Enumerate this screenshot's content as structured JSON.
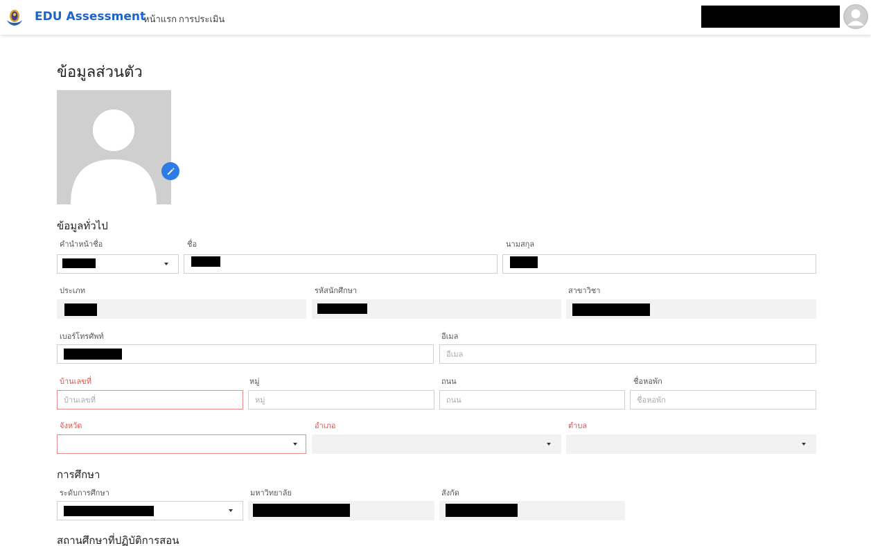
{
  "navbar": {
    "brand": "EDU Assessment",
    "links": [
      "หน้าแรก",
      "การประเมิน"
    ]
  },
  "page": {
    "title": "ข้อมูลส่วนตัว"
  },
  "sections": {
    "general": "ข้อมูลทั่วไป",
    "education": "การศึกษา",
    "practice_school": "สถานศึกษาที่ปฏิบัติการสอน"
  },
  "labels": {
    "prefix": "คำนำหน้าชื่อ",
    "first_name": "ชื่อ",
    "last_name": "นามสกุล",
    "type": "ประเภท",
    "student_id": "รหัสนักศึกษา",
    "major": "สาขาวิชา",
    "phone": "เบอร์โทรศัพท์",
    "email": "อีเมล",
    "house_no": "บ้านเลขที่",
    "moo": "หมู่",
    "road": "ถนน",
    "dorm": "ชื่อหอพัก",
    "province": "จังหวัด",
    "district": "อำเภอ",
    "subdistrict": "ตำบล",
    "edu_level": "ระดับการศึกษา",
    "university": "มหาวิทยาลัย",
    "affiliation": "สังกัด"
  },
  "placeholders": {
    "email": "อีเมล",
    "house_no": "บ้านเลขที่",
    "moo": "หมู่",
    "road": "ถนน",
    "dorm": "ชื่อหอพัก"
  },
  "icons": {
    "edit": "pencil-icon",
    "caret": "chevron-down-icon",
    "avatar": "user-avatar-icon"
  },
  "colors": {
    "brand": "#1e63c9",
    "required": "#d9534f",
    "edit_button": "#2d7be5"
  }
}
